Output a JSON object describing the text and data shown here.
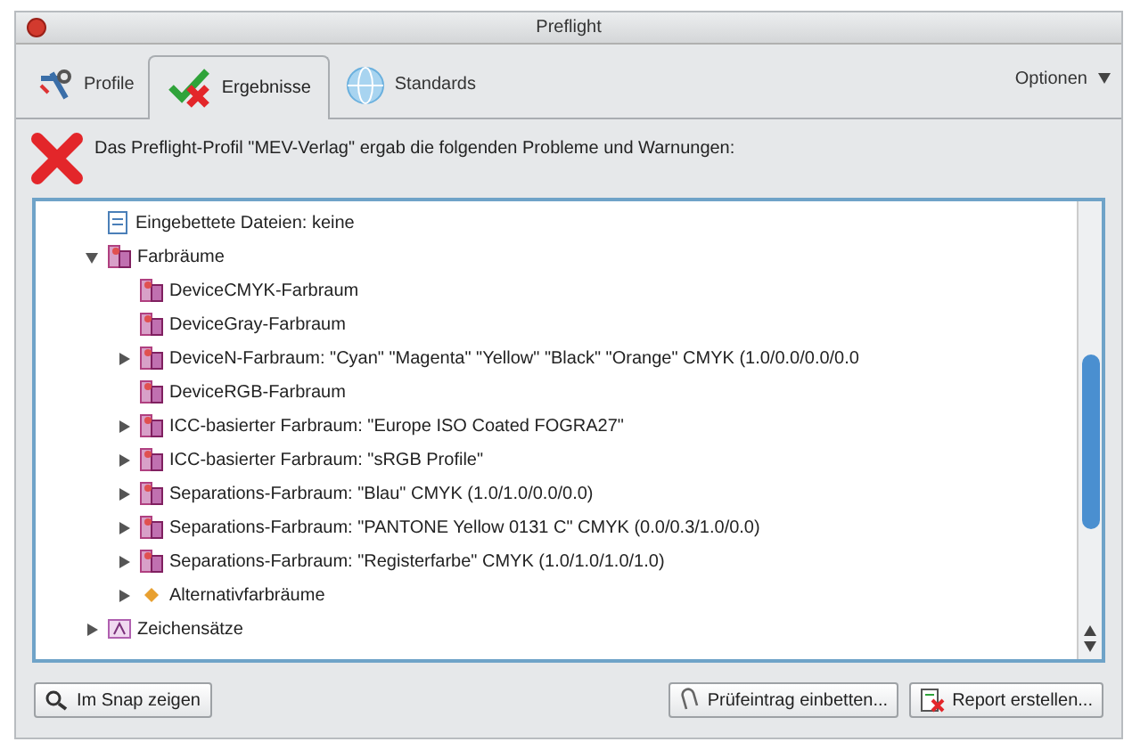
{
  "window": {
    "title": "Preflight"
  },
  "tabs": [
    {
      "label": "Profile",
      "kind": "profile",
      "selected": false
    },
    {
      "label": "Ergebnisse",
      "kind": "results",
      "selected": true
    },
    {
      "label": "Standards",
      "kind": "standards",
      "selected": false
    }
  ],
  "options_menu": {
    "label": "Optionen"
  },
  "message": "Das Preflight-Profil \"MEV-Verlag\" ergab die folgenden Probleme und Warnungen:",
  "tree": [
    {
      "label": "Eingebettete Dateien: keine",
      "kind": "file"
    },
    {
      "label": "Farbräume",
      "kind": "colorspace",
      "expanded": true,
      "children": [
        {
          "label": "DeviceCMYK-Farbraum",
          "kind": "colorspace"
        },
        {
          "label": "DeviceGray-Farbraum",
          "kind": "colorspace"
        },
        {
          "label": "DeviceN-Farbraum: \"Cyan\" \"Magenta\" \"Yellow\" \"Black\" \"Orange\" CMYK (1.0/0.0/0.0/0.0",
          "kind": "colorspace",
          "expanded": false
        },
        {
          "label": "DeviceRGB-Farbraum",
          "kind": "colorspace"
        },
        {
          "label": "ICC-basierter Farbraum: \"Europe ISO Coated FOGRA27\"",
          "kind": "colorspace",
          "expanded": false
        },
        {
          "label": "ICC-basierter Farbraum: \"sRGB Profile\"",
          "kind": "colorspace",
          "expanded": false
        },
        {
          "label": "Separations-Farbraum: \"Blau\" CMYK (1.0/1.0/0.0/0.0)",
          "kind": "colorspace",
          "expanded": false
        },
        {
          "label": "Separations-Farbraum: \"PANTONE Yellow 0131 C\" CMYK (0.0/0.3/1.0/0.0)",
          "kind": "colorspace",
          "expanded": false
        },
        {
          "label": "Separations-Farbraum: \"Registerfarbe\" CMYK (1.0/1.0/1.0/1.0)",
          "kind": "colorspace",
          "expanded": false
        },
        {
          "label": "Alternativfarbräume",
          "kind": "alternate",
          "expanded": false
        }
      ]
    },
    {
      "label": "Zeichensätze",
      "kind": "font",
      "expanded": false
    }
  ],
  "buttons": [
    {
      "label": "Im Snap zeigen",
      "kind": "snap"
    },
    {
      "label": "Prüfeintrag einbetten...",
      "kind": "embed"
    },
    {
      "label": "Report erstellen...",
      "kind": "report"
    }
  ]
}
